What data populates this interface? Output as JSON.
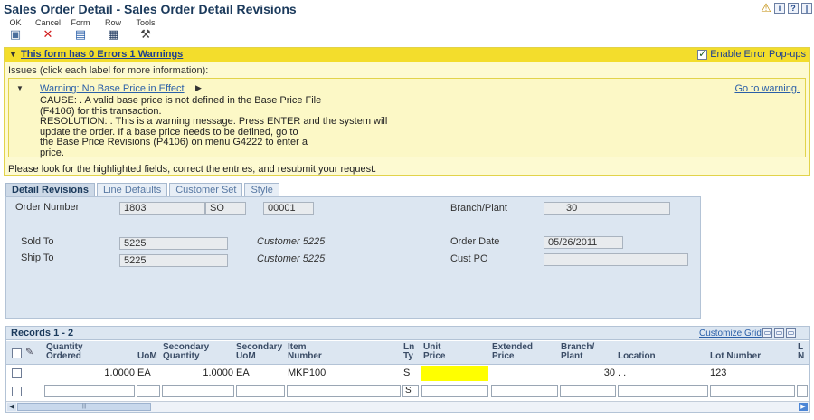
{
  "window": {
    "title": "Sales Order Detail - Sales Order Detail Revisions"
  },
  "title_icons": [
    "warning-icon",
    "info-icon",
    "help-icon",
    "more-icon"
  ],
  "toolbar": {
    "ok": "OK",
    "cancel": "Cancel",
    "form": "Form",
    "row": "Row",
    "tools": "Tools"
  },
  "errors": {
    "title": "This form has 0 Errors 1 Warnings",
    "enable_popups": "Enable Error Pop-ups",
    "enable_popups_checked": true,
    "issues_label": "Issues (click each label for more information):",
    "warning_link": "Warning: No Base Price in Effect",
    "goto": "Go to warning.",
    "lines": [
      "CAUSE: . A valid base price is not defined in the Base Price File",
      "(F4106) for this transaction.",
      "RESOLUTION: . This is a warning message. Press ENTER and the system will",
      "update the order. If a base price needs to be defined, go to",
      "the Base Price Revisions (P4106) on menu G4222 to enter a",
      "price."
    ],
    "resubmit": "Please look for the highlighted fields, correct the entries, and resubmit your request."
  },
  "tabs": [
    "Detail Revisions",
    "Line Defaults",
    "Customer Set",
    "Style"
  ],
  "detail": {
    "order_number_label": "Order Number",
    "order_number": "1803",
    "order_type": "SO",
    "order_company": "00001",
    "branch_plant_label": "Branch/Plant",
    "branch_plant": "30",
    "sold_to_label": "Sold To",
    "sold_to": "5225",
    "sold_to_name": "Customer 5225",
    "order_date_label": "Order Date",
    "order_date": "05/26/2011",
    "ship_to_label": "Ship To",
    "ship_to": "5225",
    "ship_to_name": "Customer 5225",
    "cust_po_label": "Cust PO",
    "cust_po": ""
  },
  "grid": {
    "records": "Records 1 - 2",
    "customize": "Customize Grid",
    "headers": {
      "qty1": "Quantity",
      "qty2": "Ordered",
      "uom": "UoM",
      "sec1": "Secondary",
      "sec2": "Quantity",
      "suom1": "Secondary",
      "suom2": "UoM",
      "item1": "Item",
      "item2": "Number",
      "ln1": "Ln",
      "ln2": "Ty",
      "up1": "Unit",
      "up2": "Price",
      "ep1": "Extended",
      "ep2": "Price",
      "bp1": "Branch/",
      "bp2": "Plant",
      "loc": "Location",
      "lot": "Lot Number",
      "l1": "L",
      "l2": "N"
    },
    "row": {
      "qty": "1.0000",
      "uom": "EA",
      "sec_qty": "1.0000",
      "sec_uom": "EA",
      "item": "MKP100",
      "line_type": "S",
      "unit_price": "",
      "extended_price": "",
      "branch": "30",
      "location": ". .",
      "lot": "123"
    },
    "new_row": {
      "line_type": "S"
    },
    "colors": {
      "required_highlight": "#ffff00"
    }
  }
}
